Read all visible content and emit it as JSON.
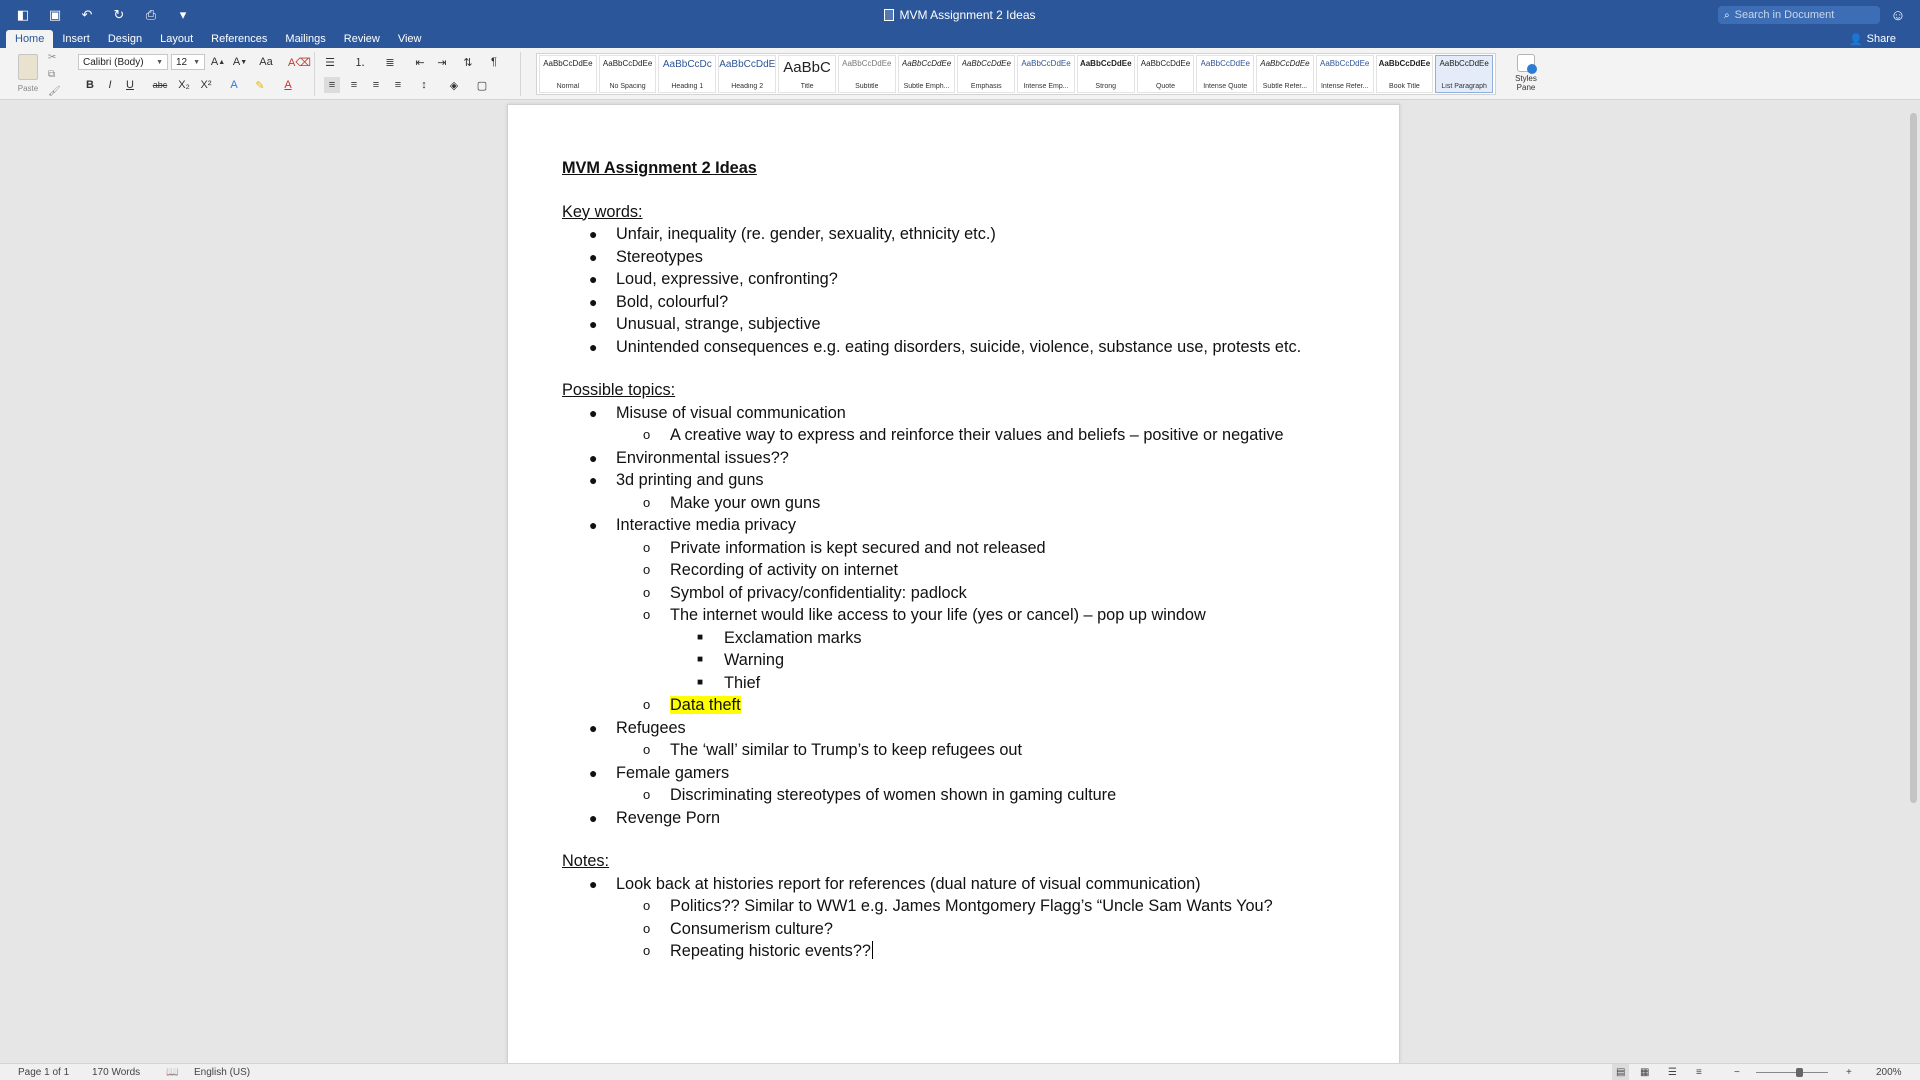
{
  "window": {
    "title": "MVM Assignment 2 Ideas",
    "search_placeholder": "Search in Document",
    "share_label": "Share"
  },
  "ribbon_tabs": [
    "Home",
    "Insert",
    "Design",
    "Layout",
    "References",
    "Mailings",
    "Review",
    "View"
  ],
  "ribbon": {
    "paste_label": "Paste",
    "font_name": "Calibri (Body)",
    "font_size": "12",
    "styles": [
      {
        "sample": "AaBbCcDdEe",
        "name": "Normal"
      },
      {
        "sample": "AaBbCcDdEe",
        "name": "No Spacing"
      },
      {
        "sample": "AaBbCcDc",
        "name": "Heading 1"
      },
      {
        "sample": "AaBbCcDdEe",
        "name": "Heading 2"
      },
      {
        "sample": "AaBbC",
        "name": "Title"
      },
      {
        "sample": "AaBbCcDdEe",
        "name": "Subtitle"
      },
      {
        "sample": "AaBbCcDdEe",
        "name": "Subtle Emph..."
      },
      {
        "sample": "AaBbCcDdEe",
        "name": "Emphasis"
      },
      {
        "sample": "AaBbCcDdEe",
        "name": "Intense Emp..."
      },
      {
        "sample": "AaBbCcDdEe",
        "name": "Strong"
      },
      {
        "sample": "AaBbCcDdEe",
        "name": "Quote"
      },
      {
        "sample": "AaBbCcDdEe",
        "name": "Intense Quote"
      },
      {
        "sample": "AaBbCcDdEe",
        "name": "Subtle Refer..."
      },
      {
        "sample": "AaBbCcDdEe",
        "name": "Intense Refer..."
      },
      {
        "sample": "AaBbCcDdEe",
        "name": "Book Title"
      },
      {
        "sample": "AaBbCcDdEe",
        "name": "List Paragraph"
      }
    ],
    "selected_style": "List Paragraph",
    "styles_pane_label": "Styles Pane"
  },
  "document": {
    "lines": [
      {
        "type": "title",
        "text": "MVM Assignment 2 Ideas"
      },
      {
        "type": "blank"
      },
      {
        "type": "heading",
        "text": "Key words:"
      },
      {
        "type": "l1",
        "text": "Unfair, inequality (re. gender, sexuality, ethnicity etc.)"
      },
      {
        "type": "l1",
        "text": "Stereotypes"
      },
      {
        "type": "l1",
        "text": "Loud, expressive, confronting?"
      },
      {
        "type": "l1",
        "text": "Bold, colourful?"
      },
      {
        "type": "l1",
        "text": "Unusual, strange, subjective"
      },
      {
        "type": "l1",
        "text": "Unintended consequences e.g. eating disorders, suicide, violence, substance use, protests etc."
      },
      {
        "type": "blank"
      },
      {
        "type": "heading",
        "text": "Possible topics:"
      },
      {
        "type": "l1",
        "text": "Misuse of visual communication"
      },
      {
        "type": "l2",
        "text": "A creative way to express and reinforce their values and beliefs – positive or negative"
      },
      {
        "type": "l1",
        "text": "Environmental issues??"
      },
      {
        "type": "l1",
        "text": "3d printing and guns"
      },
      {
        "type": "l2",
        "text": "Make your own guns"
      },
      {
        "type": "l1",
        "text": "Interactive media privacy"
      },
      {
        "type": "l2",
        "text": "Private information is kept secured and not released"
      },
      {
        "type": "l2",
        "text": "Recording of activity on internet"
      },
      {
        "type": "l2",
        "text": "Symbol of privacy/confidentiality: padlock"
      },
      {
        "type": "l2",
        "text": "The internet would like access to your life (yes or cancel) – pop up window"
      },
      {
        "type": "l3",
        "text": "Exclamation marks"
      },
      {
        "type": "l3",
        "text": "Warning"
      },
      {
        "type": "l3",
        "text": "Thief"
      },
      {
        "type": "l2",
        "text": "Data theft",
        "highlight": true
      },
      {
        "type": "l1",
        "text": "Refugees"
      },
      {
        "type": "l2",
        "text": "The ‘wall’ similar to Trump’s to keep refugees out"
      },
      {
        "type": "l1",
        "text": "Female gamers"
      },
      {
        "type": "l2",
        "text": "Discriminating stereotypes of women shown in gaming culture"
      },
      {
        "type": "l1",
        "text": "Revenge Porn"
      },
      {
        "type": "blank"
      },
      {
        "type": "heading",
        "text": "Notes:"
      },
      {
        "type": "l1",
        "text": "Look back at histories report for references (dual nature of visual communication)"
      },
      {
        "type": "l2",
        "text": "Politics?? Similar to WW1 e.g. James Montgomery Flagg’s “Uncle Sam Wants You?"
      },
      {
        "type": "l2",
        "text": "Consumerism culture?"
      },
      {
        "type": "l2",
        "text": "Repeating historic events??",
        "cursor": true
      }
    ]
  },
  "statusbar": {
    "page": "Page 1 of 1",
    "words": "170 Words",
    "language": "English (US)",
    "zoom": "200%"
  },
  "colors": {
    "accent": "#2b579a",
    "highlight": "#ffff00"
  }
}
